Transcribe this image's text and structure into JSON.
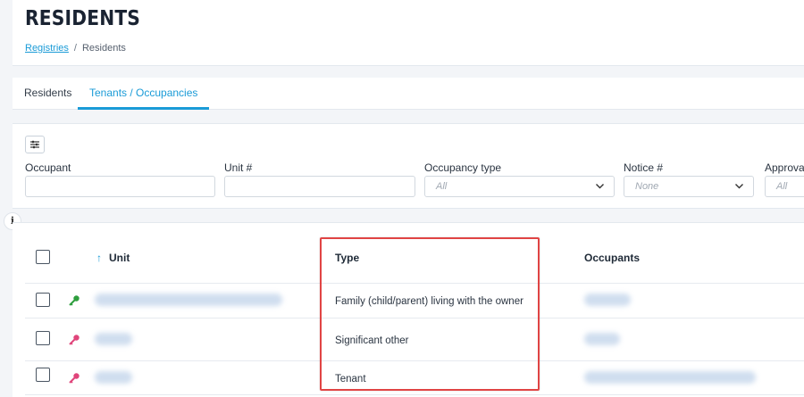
{
  "page": {
    "title": "RESIDENTS"
  },
  "breadcrumb": {
    "parent": "Registries",
    "separator": "/",
    "current": "Residents"
  },
  "tabs": [
    {
      "label": "Residents",
      "active": false
    },
    {
      "label": "Tenants / Occupancies",
      "active": true
    }
  ],
  "filters": {
    "occupant": {
      "label": "Occupant",
      "value": ""
    },
    "unit": {
      "label": "Unit #",
      "value": ""
    },
    "occupancy_type": {
      "label": "Occupancy type",
      "value": "All"
    },
    "notice": {
      "label": "Notice #",
      "value": "None"
    },
    "approval": {
      "label": "Approva",
      "value": "All"
    }
  },
  "table": {
    "columns": {
      "unit": "Unit",
      "type": "Type",
      "occupants": "Occupants"
    },
    "sort_indicator": "↑",
    "rows": [
      {
        "key_color": "#2e9e3e",
        "unit": "",
        "type": "Family (child/parent) living with the owner",
        "occupants": ""
      },
      {
        "key_color": "#e0457b",
        "unit": "",
        "type": "Significant other",
        "occupants": ""
      },
      {
        "key_color": "#e0457b",
        "unit": "",
        "type": "Tenant",
        "occupants": ""
      }
    ]
  },
  "icons": {
    "filter": "sliders-icon",
    "info": "info-icon",
    "sort": "arrow-up-icon",
    "key": "key-icon",
    "chevron": "chevron-down-icon"
  },
  "colors": {
    "accent": "#1a9bd7",
    "highlight": "#e04444"
  }
}
